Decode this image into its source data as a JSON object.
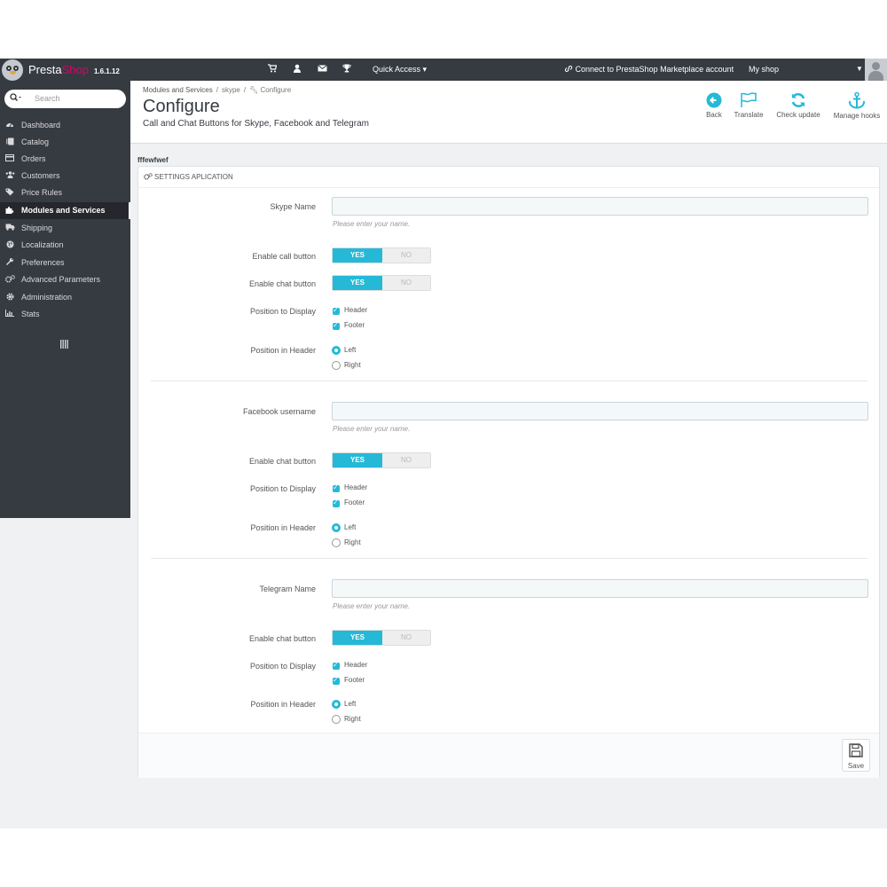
{
  "topbar": {
    "brand_presta": "Presta",
    "brand_shop": "Shop",
    "version": "1.6.1.12",
    "quick_access": "Quick Access ▾",
    "connect": "Connect to PrestaShop Marketplace account",
    "my_shop": "My shop",
    "icons": [
      "cart-icon",
      "user-icon",
      "mail-icon",
      "trophy-icon"
    ]
  },
  "sidebar": {
    "search_placeholder": "Search",
    "items": [
      {
        "label": "Dashboard",
        "icon": "dashboard-icon"
      },
      {
        "label": "Catalog",
        "icon": "book-icon"
      },
      {
        "label": "Orders",
        "icon": "credit-card-icon"
      },
      {
        "label": "Customers",
        "icon": "users-icon"
      },
      {
        "label": "Price Rules",
        "icon": "tag-icon"
      },
      {
        "label": "Modules and Services",
        "icon": "puzzle-icon",
        "active": true
      },
      {
        "label": "Shipping",
        "icon": "truck-icon"
      },
      {
        "label": "Localization",
        "icon": "globe-icon"
      },
      {
        "label": "Preferences",
        "icon": "wrench-icon"
      },
      {
        "label": "Advanced Parameters",
        "icon": "cogs-icon"
      },
      {
        "label": "Administration",
        "icon": "gear-icon"
      },
      {
        "label": "Stats",
        "icon": "bar-chart-icon"
      }
    ]
  },
  "header": {
    "breadcrumb": [
      "Modules and Services",
      "skype",
      "Configure"
    ],
    "title": "Configure",
    "subtitle": "Call and Chat Buttons for Skype, Facebook and Telegram",
    "toolbar": [
      {
        "label": "Back",
        "icon": "arrow-left-circle-icon"
      },
      {
        "label": "Translate",
        "icon": "flag-icon"
      },
      {
        "label": "Check update",
        "icon": "refresh-icon"
      },
      {
        "label": "Manage hooks",
        "icon": "anchor-icon"
      }
    ]
  },
  "form": {
    "section_title": "fffewfwef",
    "panel_title": "SETTINGS APLICATION",
    "help_text": "Please enter your name.",
    "yes": "YES",
    "no": "NO",
    "skype": {
      "name_label": "Skype Name",
      "name_value": "",
      "call_label": "Enable call button",
      "chat_label": "Enable chat button",
      "display_label": "Position to Display",
      "header_label": "Position in Header"
    },
    "facebook": {
      "name_label": "Facebook username",
      "name_value": "",
      "chat_label": "Enable chat button",
      "display_label": "Position to Display",
      "header_label": "Position in Header"
    },
    "telegram": {
      "name_label": "Telegram Name",
      "name_value": "",
      "chat_label": "Enable chat button",
      "display_label": "Position to Display",
      "header_label": "Position in Header"
    },
    "opt_header": "Header",
    "opt_footer": "Footer",
    "opt_left": "Left",
    "opt_right": "Right",
    "save_label": "Save"
  },
  "colors": {
    "accent": "#25b9d7",
    "sidebar": "#363a41",
    "brand": "#df0067"
  }
}
